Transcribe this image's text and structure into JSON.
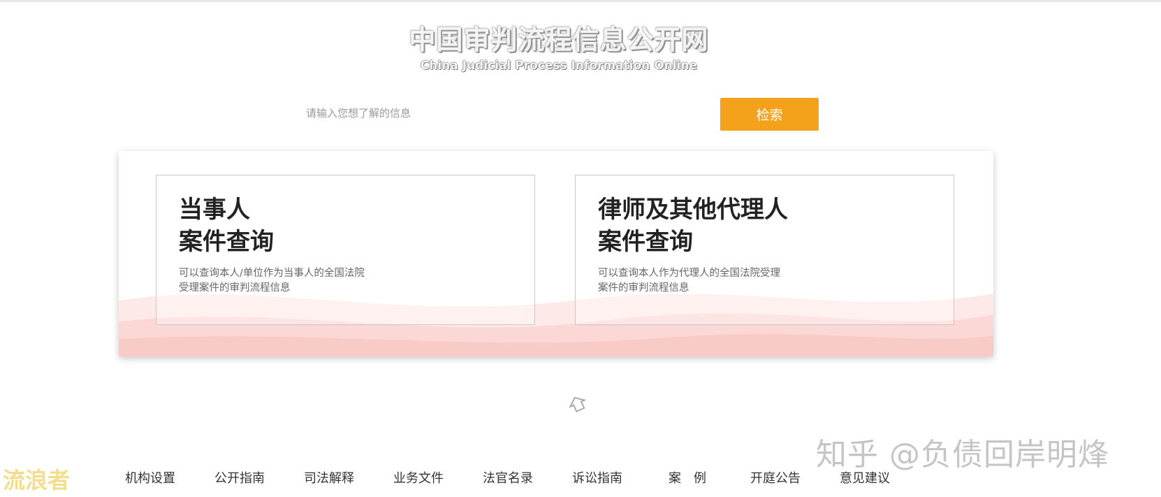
{
  "header": {
    "logo_cn": "中国审判流程信息公开网",
    "logo_en": "China Judicial Process Information Online"
  },
  "search": {
    "placeholder": "请输入您想了解的信息",
    "value": "",
    "button_label": "检索"
  },
  "cards": [
    {
      "title": "当事人\n案件查询",
      "description": "可以查询本人/单位作为当事人的全国法院\n受理案件的审判流程信息"
    },
    {
      "title": "律师及其他代理人\n案件查询",
      "description": "可以查询本人作为代理人的全国法院受理\n案件的审判流程信息"
    }
  ],
  "scroll_icon": "arrow-icon",
  "footer_nav": [
    "机构设置",
    "公开指南",
    "司法解释",
    "业务文件",
    "法官名录",
    "诉讼指南",
    "案　例",
    "开庭公告",
    "意见建议"
  ],
  "watermarks": {
    "zhihu": "知乎 @负债回岸明烽",
    "left": "流浪者"
  },
  "colors": {
    "accent": "#f4a21c",
    "wave": "#f9c9c4"
  }
}
